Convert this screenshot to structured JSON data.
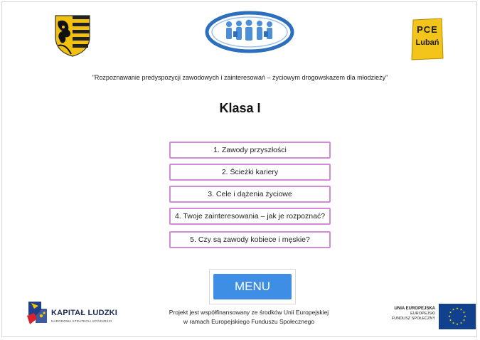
{
  "header": {
    "pce_logo_line1": "PCE",
    "pce_logo_line2": "Lubań"
  },
  "subtitle": "\"Rozpoznawanie predyspozycji zawodowych i zainteresowań – życiowym drogowskazem dla młodzieży\"",
  "title": "Klasa I",
  "options": [
    "1. Zawody przyszłości",
    "2. Ścieżki kariery",
    "3. Cele i dążenia życiowe",
    "4. Twoje zainteresowania – jak je rozpoznać?",
    "5. Czy są zawody kobiece i męskie?"
  ],
  "menu_label": "MENU",
  "footer": {
    "kapital_ludzki": "KAPITAŁ LUDZKI",
    "kapital_sub": "NARODOWA STRATEGIA SPÓJNOŚCI",
    "project_line1": "Projekt jest współfinansowany ze środków Unii Europejskiej",
    "project_line2": "w ramach Europejskiego Funduszu Społecznego",
    "eu_line1": "UNIA EUROPEJSKA",
    "eu_line2": "EUROPEJSKI",
    "eu_line3": "FUNDUSZ SPOŁECZNY"
  },
  "colors": {
    "option_border": "#d58ad8",
    "menu_button": "#3f8ee6",
    "eu_blue": "#10408e",
    "eu_star": "#ffdd00"
  }
}
